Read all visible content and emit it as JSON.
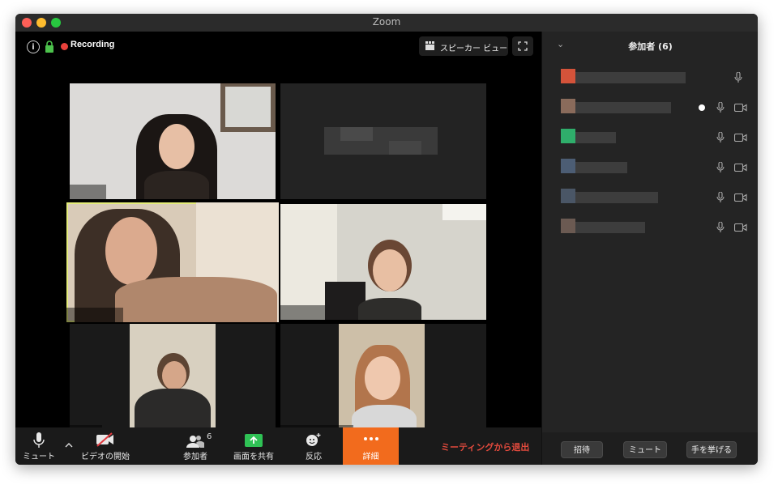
{
  "window": {
    "title": "Zoom"
  },
  "meeting": {
    "recording_label": "Recording",
    "view_label": "スピーカー ビュー"
  },
  "toolbar": {
    "mute_label": "ミュート",
    "video_label": "ビデオの開始",
    "participants_label": "参加者",
    "participants_count": "6",
    "share_label": "画面を共有",
    "reaction_label": "反応",
    "more_label": "詳細",
    "leave_label": "ミーティングから退出"
  },
  "panel": {
    "title": "参加者 (6)",
    "invite_label": "招待",
    "mute_label": "ミュート",
    "raise_hand_label": "手を挙げる"
  },
  "colors": {
    "active_speaker_border": "#e4ec7a",
    "recording_dot": "#e8413b",
    "more_button": "#f26b1d",
    "leave_text": "#e24a3d"
  },
  "icons": [
    "info-icon",
    "lock-icon",
    "grid-icon",
    "fullscreen-icon",
    "microphone-icon",
    "chevron-up-icon",
    "video-off-icon",
    "participants-icon",
    "share-screen-icon",
    "reaction-icon",
    "more-icon",
    "camera-icon"
  ]
}
